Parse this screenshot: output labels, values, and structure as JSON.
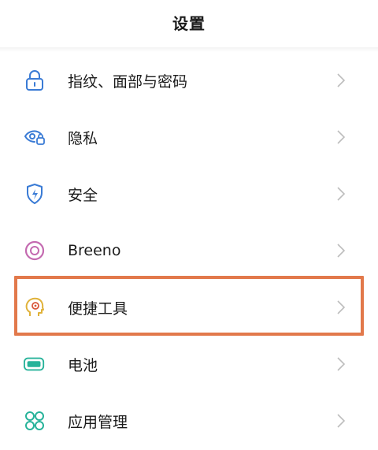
{
  "header": {
    "title": "设置"
  },
  "settings_list": [
    {
      "label": "指纹、面部与密码",
      "icon": "lock-icon"
    },
    {
      "label": "隐私",
      "icon": "privacy-eye-icon"
    },
    {
      "label": "安全",
      "icon": "shield-icon"
    },
    {
      "label": "Breeno",
      "icon": "breeno-icon"
    },
    {
      "label": "便捷工具",
      "icon": "tools-head-icon"
    },
    {
      "label": "电池",
      "icon": "battery-icon"
    },
    {
      "label": "应用管理",
      "icon": "app-grid-icon"
    }
  ],
  "colors": {
    "highlight": "#e2794b",
    "icon_blue": "#3a7bd5",
    "icon_purple": "#c46ab0",
    "icon_yellow": "#e0b23a",
    "icon_teal": "#27b39a",
    "chevron": "#bdbdbd"
  }
}
